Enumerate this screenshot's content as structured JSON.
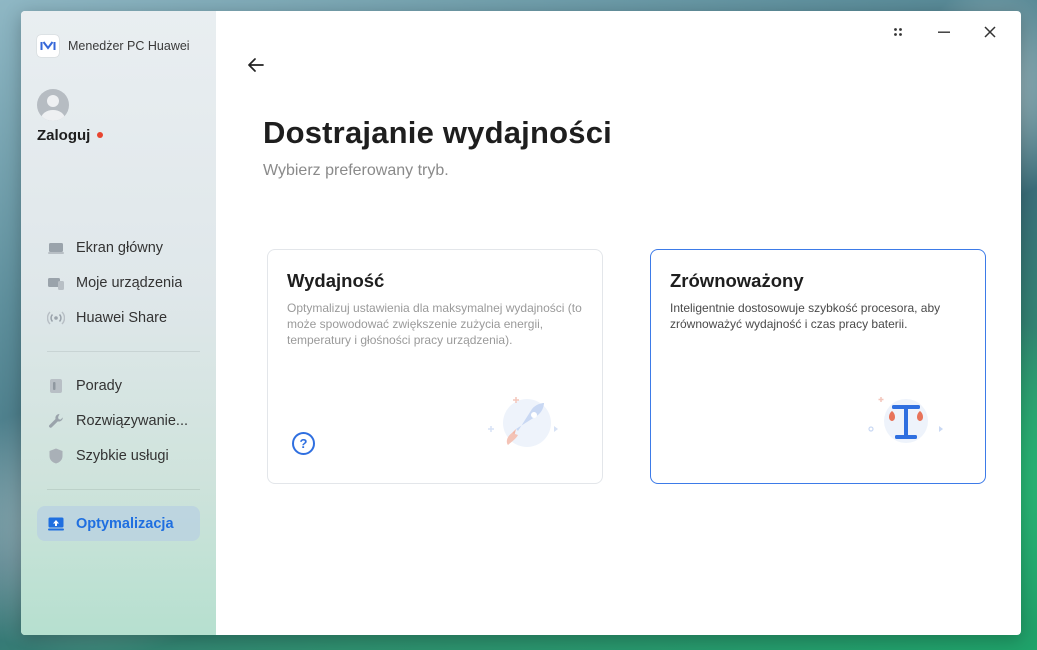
{
  "app": {
    "name": "Menedżer PC Huawei",
    "logo_text": "M"
  },
  "account": {
    "login_label": "Zaloguj"
  },
  "sidebar": {
    "items": [
      {
        "label": "Ekran główny",
        "icon": "laptop-icon"
      },
      {
        "label": "Moje urządzenia",
        "icon": "devices-icon"
      },
      {
        "label": "Huawei Share",
        "icon": "share-waves-icon"
      }
    ],
    "items2": [
      {
        "label": "Porady",
        "icon": "tips-icon"
      },
      {
        "label": "Rozwiązywanie...",
        "icon": "wrench-icon"
      },
      {
        "label": "Szybkie usługi",
        "icon": "shield-icon"
      }
    ],
    "active": {
      "label": "Optymalizacja",
      "icon": "optimization-icon"
    }
  },
  "page": {
    "title": "Dostrajanie wydajności",
    "subtitle": "Wybierz preferowany tryb."
  },
  "modes": [
    {
      "title": "Wydajność",
      "description": "Optymalizuj ustawienia dla maksymalnej wydajności (to może spowodować zwiększenie zużycia energii, temperatury i głośności pracy urządzenia).",
      "help": "?",
      "selected": false
    },
    {
      "title": "Zrównoważony",
      "description": "Inteligentnie dostosowuje szybkość procesora, aby zrównoważyć wydajność i czas pracy baterii.",
      "selected": true
    }
  ],
  "colors": {
    "accent": "#1f6fe0",
    "selected_border": "#3d7be8",
    "badge": "#e8442f"
  }
}
